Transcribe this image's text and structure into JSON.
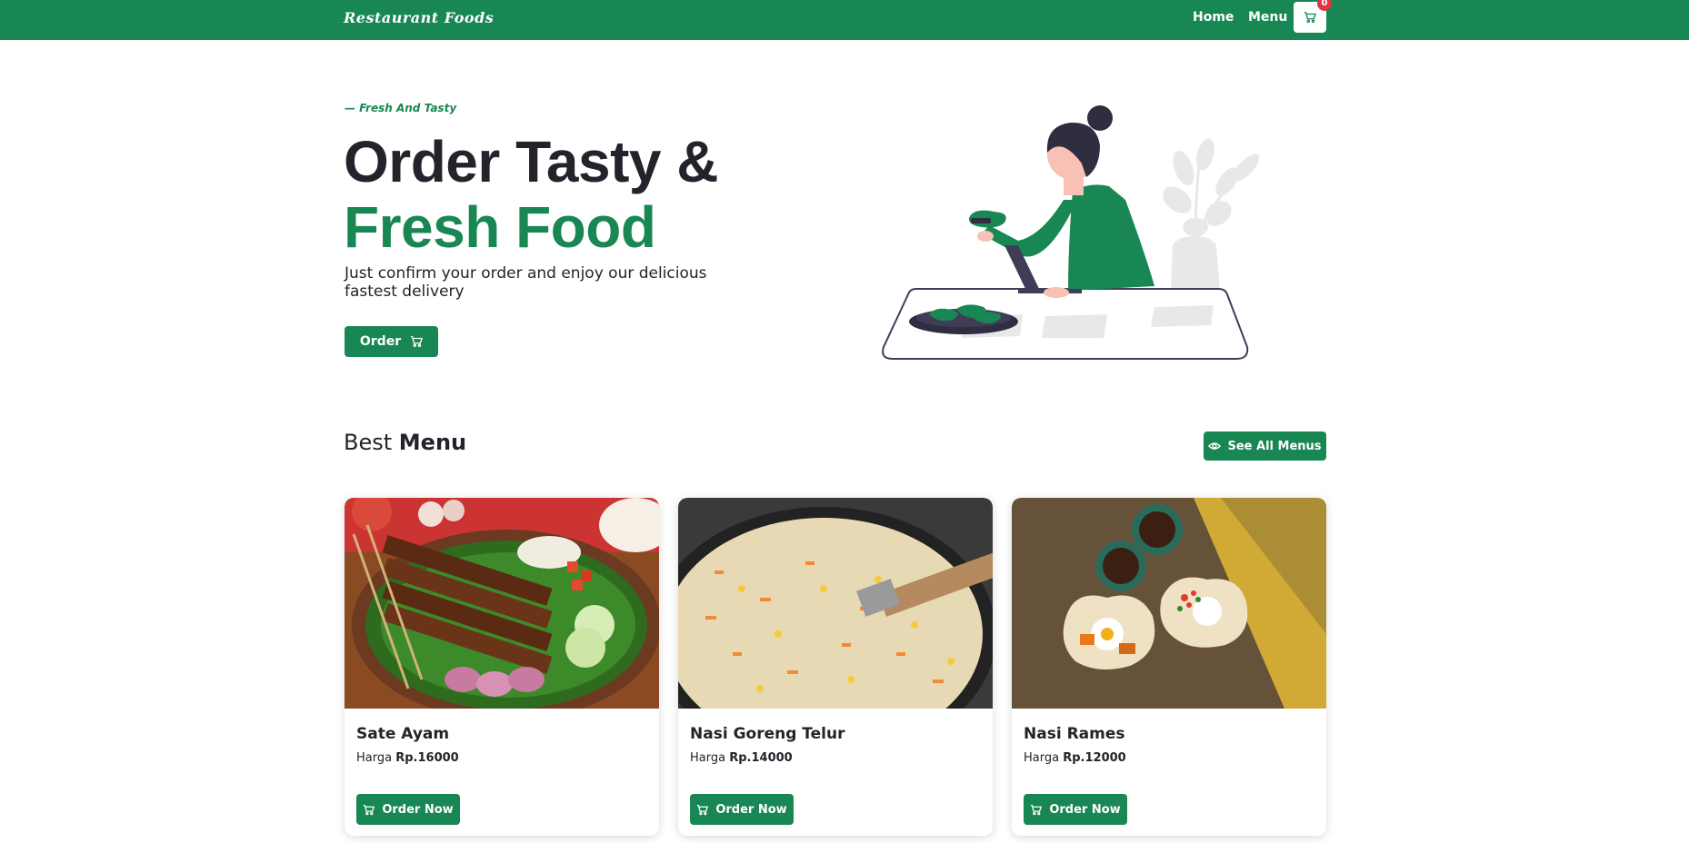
{
  "navbar": {
    "brand": "Restaurant Foods",
    "links": [
      "Home",
      "Menu"
    ],
    "cart_count": "0"
  },
  "hero": {
    "tagline": "— Fresh And Tasty",
    "title_line1": "Order Tasty &",
    "title_line2": "Fresh Food",
    "subtitle": "Just confirm your order and enjoy our delicious fastest delivery",
    "order_button": "Order"
  },
  "best_menu": {
    "title_light": "Best",
    "title_bold": "Menu",
    "see_all_button": "See All Menus",
    "items": [
      {
        "name": "Sate Ayam",
        "price_label": "Harga",
        "price": "Rp.16000",
        "button": "Order Now"
      },
      {
        "name": "Nasi Goreng Telur",
        "price_label": "Harga",
        "price": "Rp.14000",
        "button": "Order Now"
      },
      {
        "name": "Nasi Rames",
        "price_label": "Harga",
        "price": "Rp.12000",
        "button": "Order Now"
      }
    ]
  },
  "colors": {
    "primary": "#198754",
    "dark": "#23232b",
    "badge": "#dc3545"
  },
  "icons": [
    "cart-icon",
    "eye-icon"
  ]
}
